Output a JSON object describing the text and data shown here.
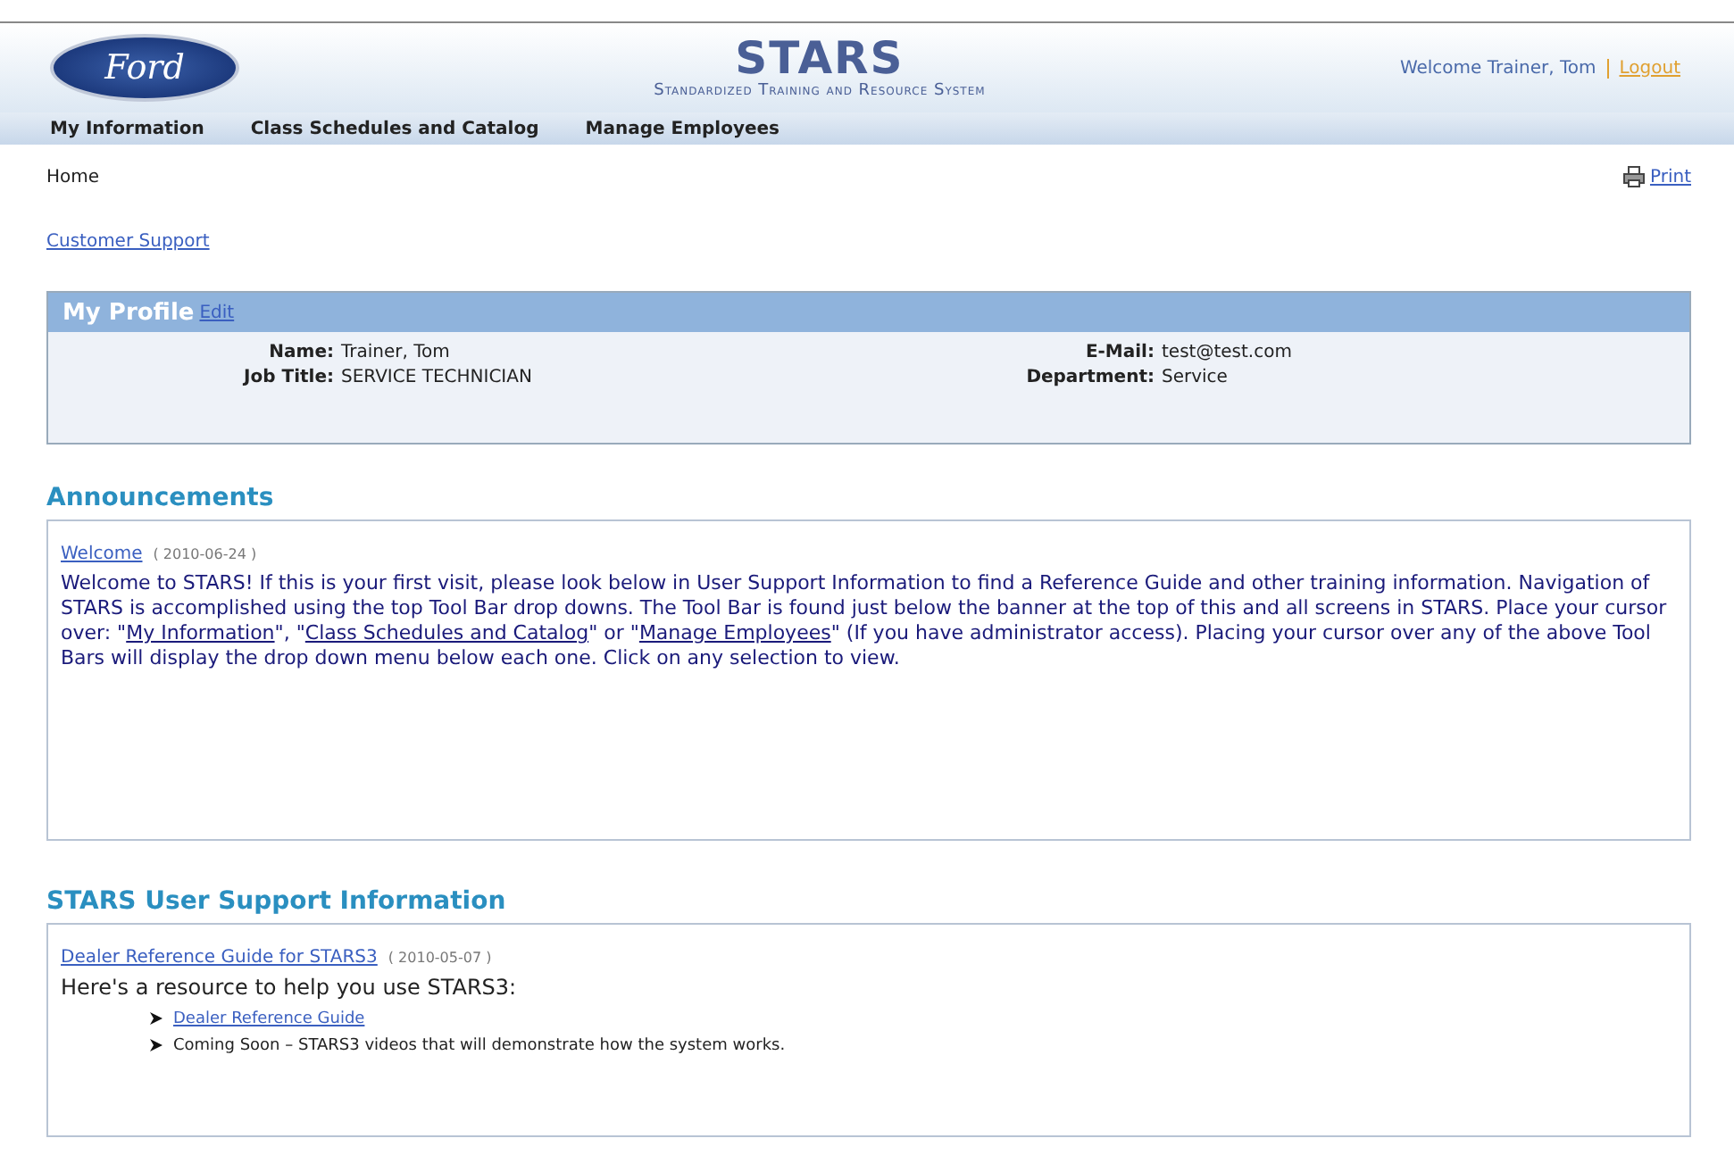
{
  "header": {
    "logo": "Ford",
    "title": "STARS",
    "subtitle": "Standardized Training and Resource System",
    "welcome": "Welcome Trainer, Tom",
    "logout": "Logout"
  },
  "nav": [
    "My Information",
    "Class Schedules and Catalog",
    "Manage Employees"
  ],
  "breadcrumb": "Home",
  "print": "Print",
  "support_link": "Customer Support",
  "profile": {
    "title": "My Profile",
    "edit": "Edit",
    "fields": [
      {
        "label": "Name:",
        "value": "Trainer, Tom"
      },
      {
        "label": "E-Mail:",
        "value": "test@test.com"
      },
      {
        "label": "Job Title:",
        "value": "SERVICE TECHNICIAN"
      },
      {
        "label": "Department:",
        "value": "Service"
      }
    ]
  },
  "announcements": {
    "title": "Announcements",
    "items": [
      {
        "link": "Welcome",
        "date": "( 2010-06-24 )",
        "body": [
          {
            "kind": "text",
            "text": "Welcome to STARS! If this is your first visit, please look below in User Support Information to find a Reference Guide and other training information.  Navigation of STARS is accomplished using the top Tool Bar drop downs. The Tool Bar is found just below the banner at the top of this and all screens in STARS. Place your cursor over: \""
          },
          {
            "kind": "link",
            "text": "My Information"
          },
          {
            "kind": "text",
            "text": "\", \""
          },
          {
            "kind": "link",
            "text": "Class Schedules and Catalog"
          },
          {
            "kind": "text",
            "text": "\" or \""
          },
          {
            "kind": "link",
            "text": "Manage Employees"
          },
          {
            "kind": "text",
            "text": "\" (If you have administrator access). Placing your cursor over any of the above Tool Bars will display the drop down menu below each one. Click on any selection to view."
          }
        ]
      }
    ]
  },
  "support": {
    "title": "STARS User Support Information",
    "items": [
      {
        "link": "Dealer Reference Guide for STARS3",
        "date": "( 2010-05-07 )",
        "intro": "Here's a resource to help you use STARS3:",
        "bullets": [
          {
            "kind": "link",
            "text": "Dealer Reference Guide"
          },
          {
            "kind": "text",
            "text": "Coming Soon – STARS3 videos that will demonstrate how the system works."
          }
        ]
      }
    ]
  }
}
